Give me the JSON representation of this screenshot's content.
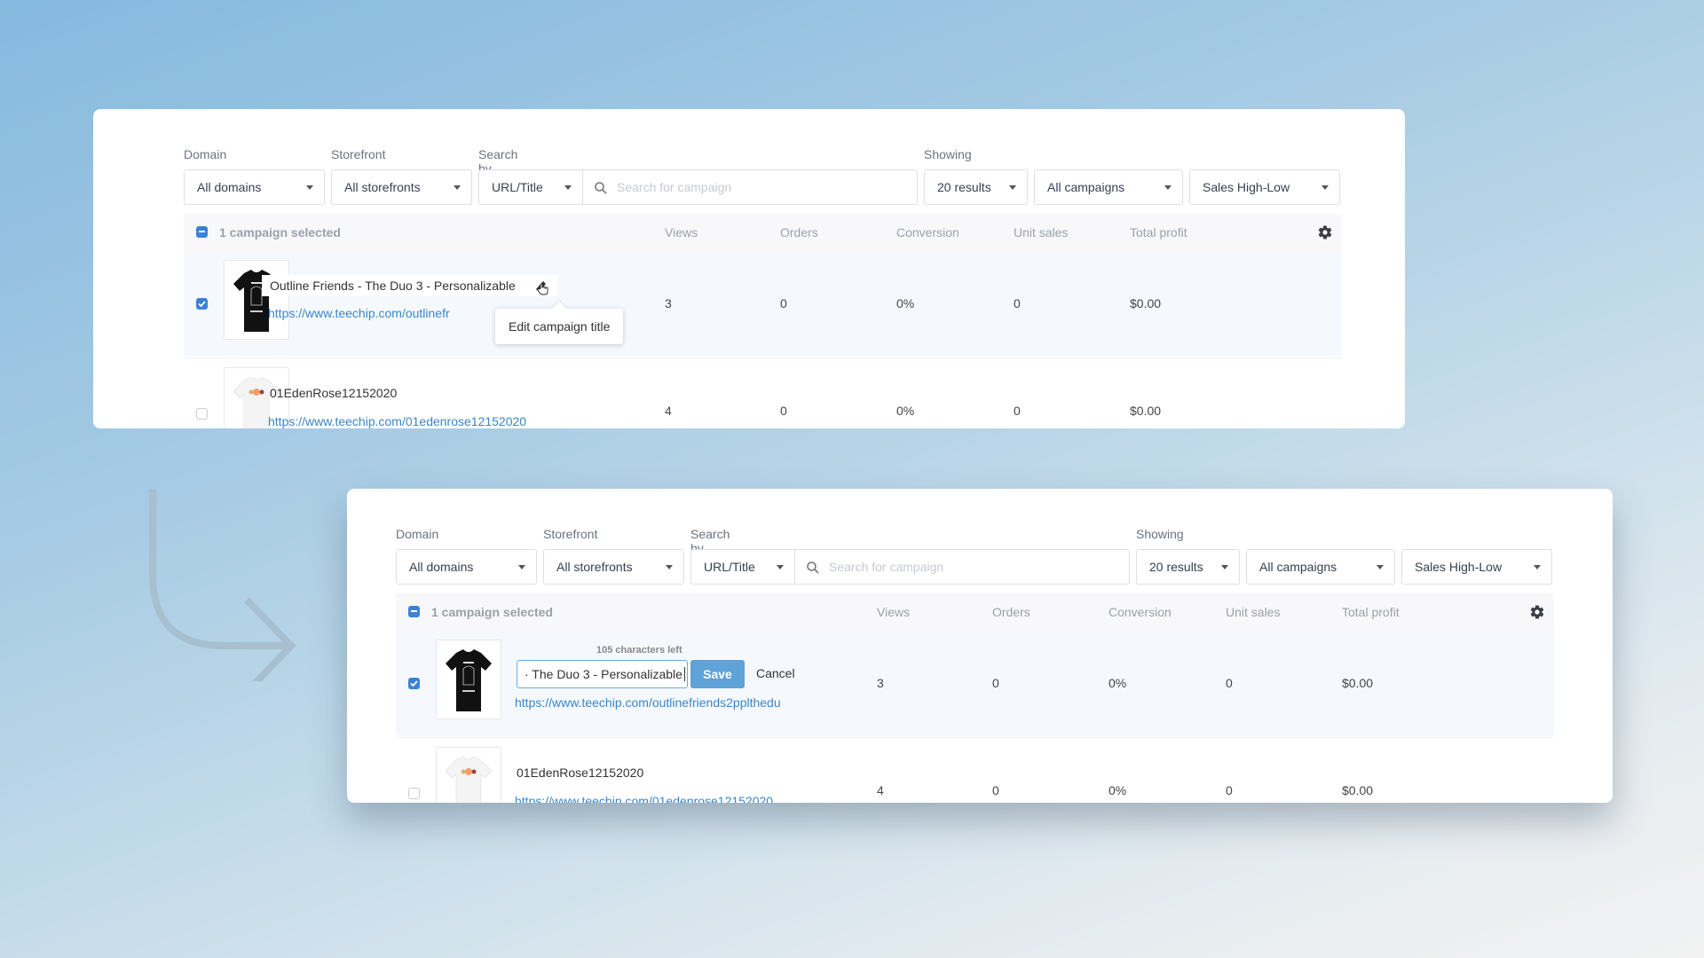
{
  "filters": {
    "domain_label": "Domain",
    "domain_value": "All domains",
    "storefront_label": "Storefront",
    "storefront_value": "All storefronts",
    "searchby_label": "Search by",
    "searchby_value": "URL/Title",
    "search_placeholder": "Search for campaign",
    "showing_label": "Showing",
    "showing_value": "20 results",
    "campaigns_value": "All campaigns",
    "sort_value": "Sales High-Low"
  },
  "table": {
    "selection_text": "1 campaign selected",
    "columns": [
      "Views",
      "Orders",
      "Conversion",
      "Unit sales",
      "Total profit"
    ],
    "rows": [
      {
        "title": "Outline Friends - The Duo 3 - Personalizable",
        "url": "https://www.teechip.com/outlinefriends2pplthedu",
        "url_truncated": "https://www.teechip.com/outlinefr",
        "selected": true,
        "shirt_color": "#111111",
        "views": "3",
        "orders": "0",
        "conversion": "0%",
        "unit_sales": "0",
        "total_profit": "$0.00"
      },
      {
        "title": "01EdenRose12152020",
        "url": "https://www.teechip.com/01edenrose12152020",
        "selected": false,
        "shirt_color": "#f4f4f4",
        "views": "4",
        "orders": "0",
        "conversion": "0%",
        "unit_sales": "0",
        "total_profit": "$0.00"
      }
    ]
  },
  "before": {
    "tooltip": "Edit campaign title"
  },
  "after": {
    "chars_left": "105 characters left",
    "edit_value": "· The Duo 3 - Personalizable",
    "save_label": "Save",
    "cancel_label": "Cancel"
  },
  "colors": {
    "accent": "#3b82d6",
    "link": "#3a86c8",
    "save_button": "#5fa3d8"
  }
}
